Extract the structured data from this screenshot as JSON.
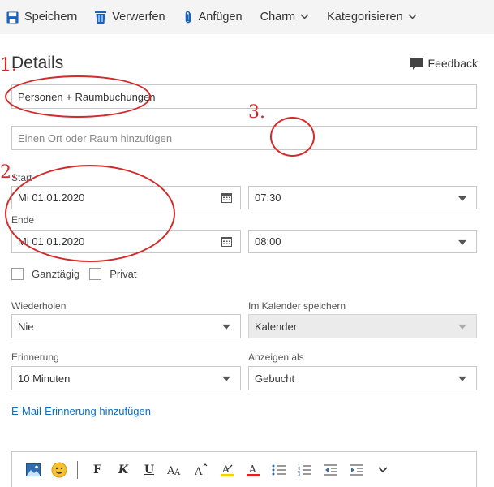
{
  "toolbar": {
    "save_label": "Speichern",
    "discard_label": "Verwerfen",
    "attach_label": "Anfügen",
    "charm_label": "Charm",
    "categorize_label": "Kategorisieren"
  },
  "header": {
    "title": "Details",
    "feedback_label": "Feedback"
  },
  "form": {
    "title_value": "Personen + Raumbuchungen",
    "location_placeholder": "Einen Ort oder Raum hinzufügen",
    "start_label": "Start",
    "start_date": "Mi 01.01.2020",
    "start_time": "07:30",
    "end_label": "Ende",
    "end_date": "Mi 01.01.2020",
    "end_time": "08:00",
    "allday_label": "Ganztägig",
    "private_label": "Privat",
    "repeat_label": "Wiederholen",
    "repeat_value": "Nie",
    "calendar_label": "Im Kalender speichern",
    "calendar_value": "Kalender",
    "reminder_label": "Erinnerung",
    "reminder_value": "10 Minuten",
    "showas_label": "Anzeigen als",
    "showas_value": "Gebucht",
    "email_reminder_link": "E-Mail-Erinnerung hinzufügen"
  },
  "editor": {
    "bold": "F",
    "italic": "K",
    "underline": "U"
  },
  "annotations": {
    "n1": "1.",
    "n2": "2.",
    "n3": "3."
  },
  "colors": {
    "accent": "#0f6cbd",
    "annotation_red": "#d42a2a",
    "link": "#106ebe",
    "toolbar_bg": "#f4f4f4"
  },
  "icons": [
    "save-icon",
    "trash-icon",
    "paperclip-icon",
    "chevron-down-icon",
    "feedback-icon",
    "calendar-icon",
    "image-icon",
    "emoji-icon",
    "font-size-icon",
    "superscript-icon",
    "highlight-icon",
    "font-color-icon",
    "bullet-list-icon",
    "numbered-list-icon",
    "outdent-icon",
    "indent-icon"
  ]
}
